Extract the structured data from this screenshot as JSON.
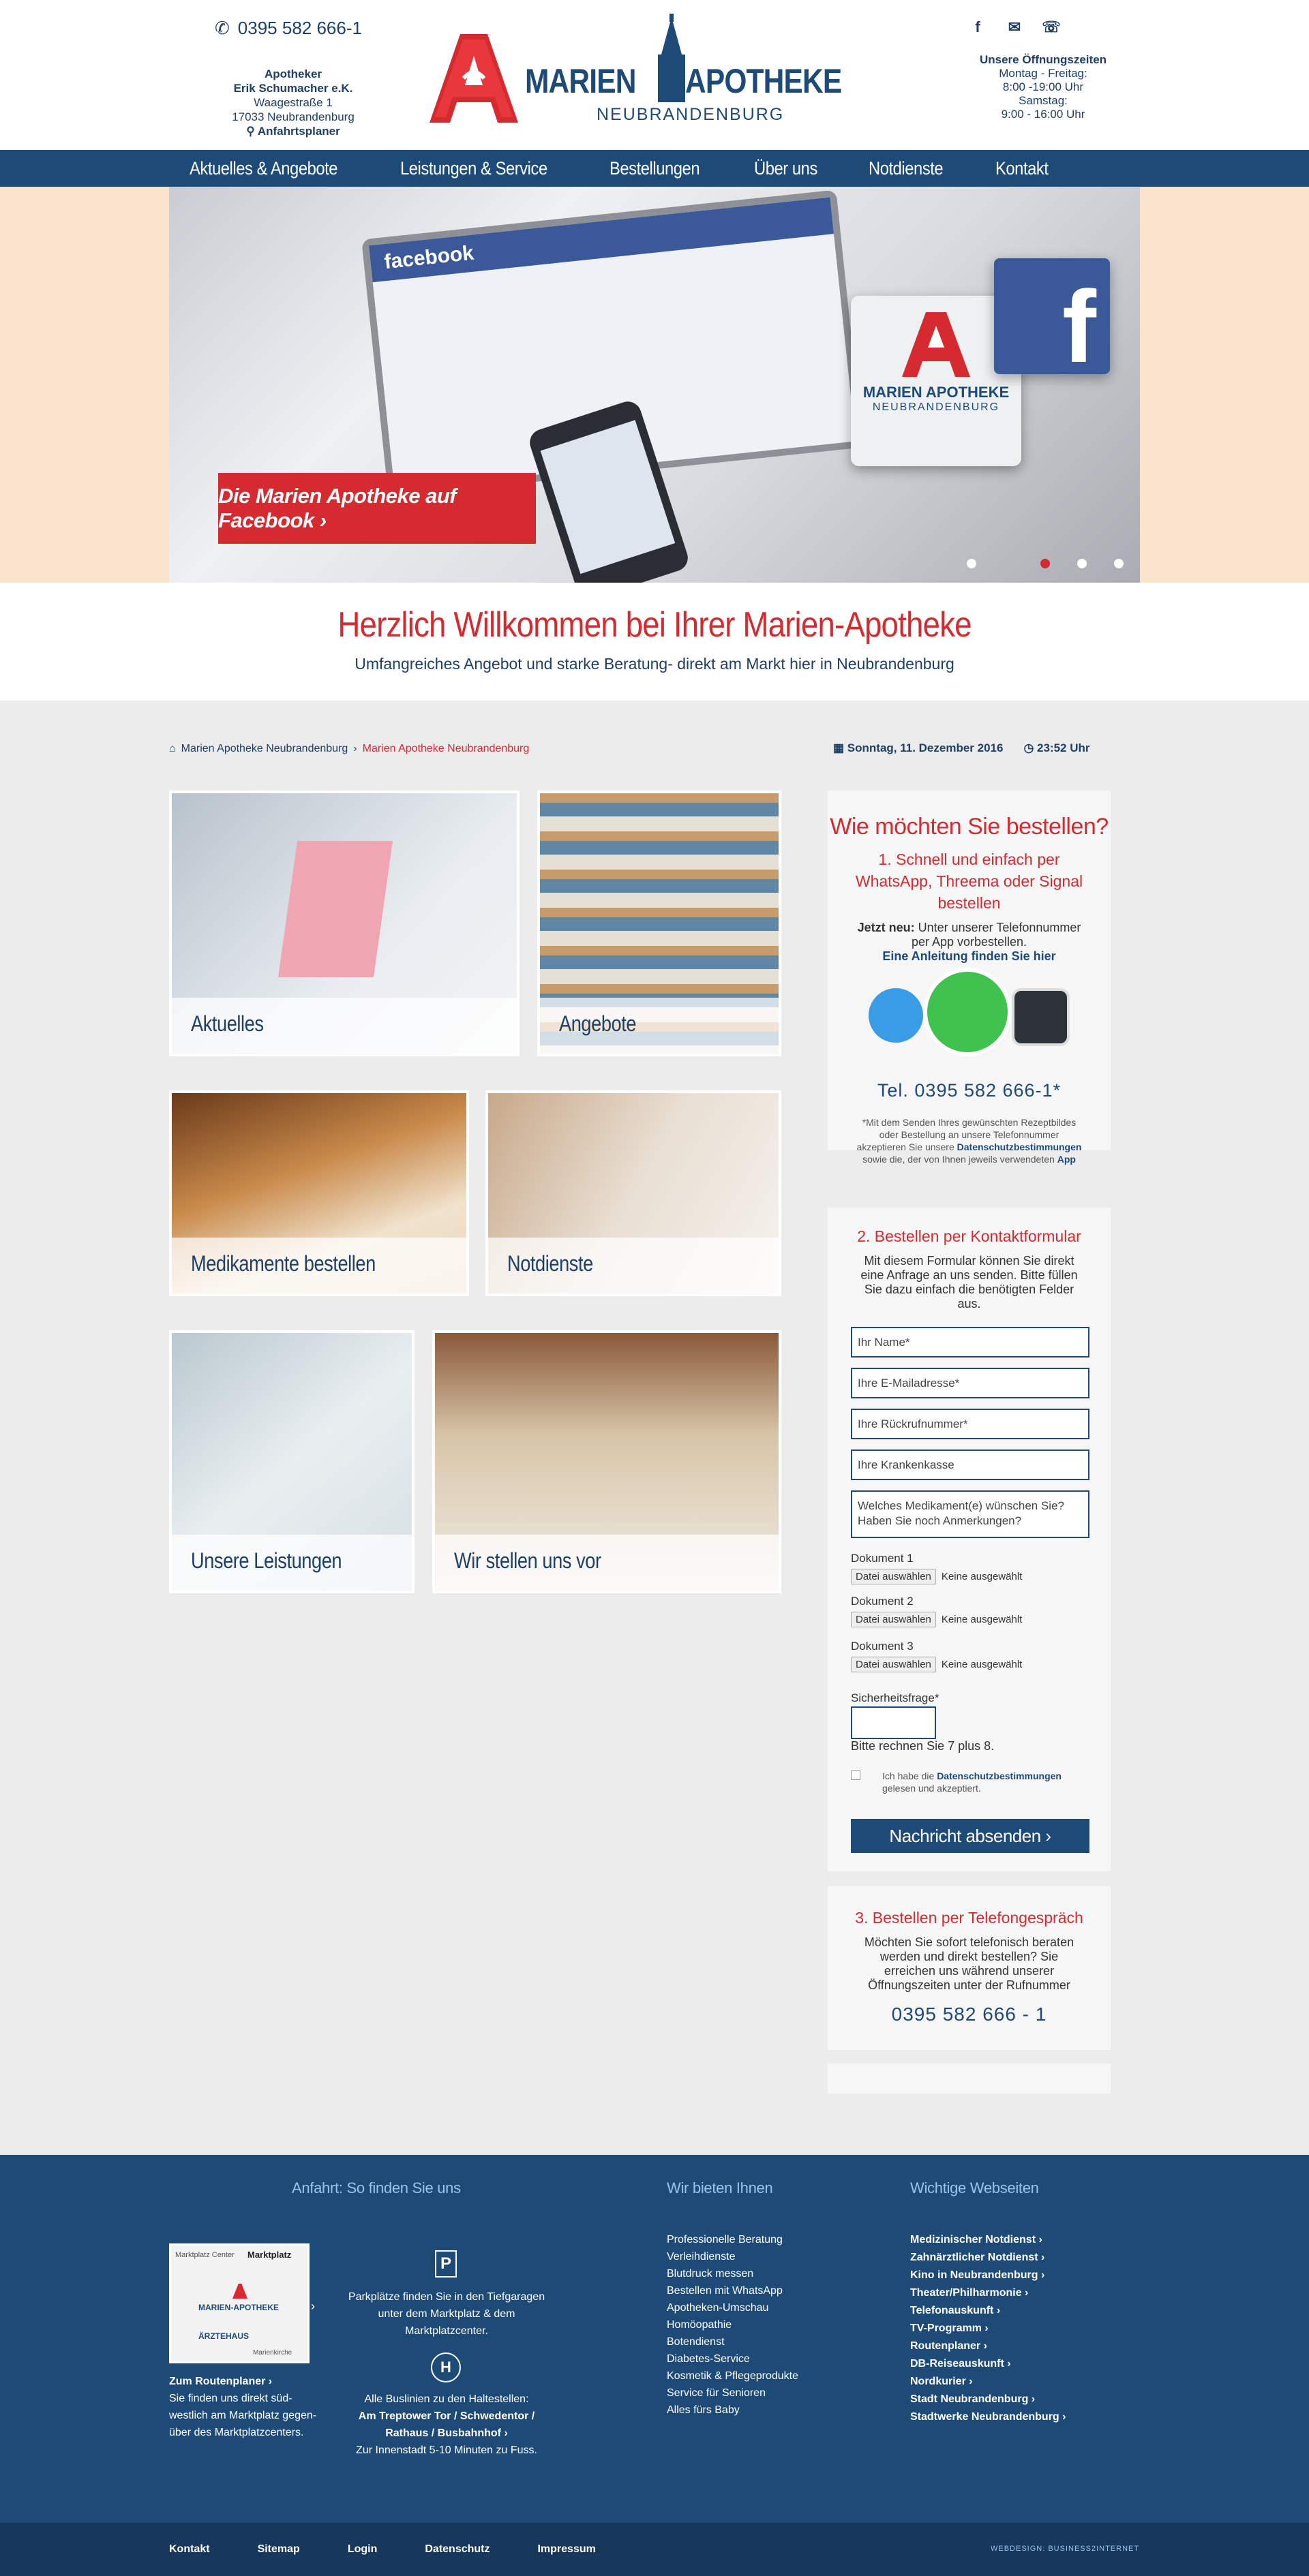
{
  "header": {
    "phone": "0395 582 666-1",
    "address": {
      "line1": "Apotheker",
      "line2": "Erik Schumacher e.K.",
      "line3": "Waagestraße 1",
      "line4": "17033 Neubrandenburg",
      "route_link": "Anfahrtsplaner"
    },
    "logo": {
      "word1": "MARIEN",
      "word2": "APOTHEKE",
      "city": "NEUBRANDENBURG"
    },
    "hours": {
      "title": "Unsere Öffnungszeiten",
      "line1": "Montag - Freitag:",
      "line2": "8:00 -19:00 Uhr",
      "line3": "Samstag:",
      "line4": "9:00 - 16:00 Uhr"
    }
  },
  "nav": {
    "items": [
      {
        "label": "Aktuelles & Angebote"
      },
      {
        "label": "Leistungen & Service"
      },
      {
        "label": "Bestellungen"
      },
      {
        "label": "Über uns"
      },
      {
        "label": "Notdienste"
      },
      {
        "label": "Kontakt"
      }
    ]
  },
  "hero": {
    "button": "Die Marien Apotheke auf Facebook ›",
    "screen_brand": "facebook",
    "badge_word1": "MARIEN APOTHEKE",
    "badge_word2": "NEUBRANDENBURG",
    "fb_letter": "f",
    "active_slide": 3,
    "slides": 5
  },
  "welcome": {
    "title": "Herzlich Willkommen bei Ihrer Marien-Apotheke",
    "subtitle": "Umfangreiches Angebot und starke Beratung- direkt am Markt hier in Neubrandenburg"
  },
  "breadcrumb": {
    "home": "Marien Apotheke Neubrandenburg",
    "current": "Marien Apotheke Neubrandenburg"
  },
  "datetime": {
    "date": "Sonntag, 11. Dezember 2016",
    "time": "23:52 Uhr"
  },
  "tiles": [
    {
      "label": "Aktuelles"
    },
    {
      "label": "Angebote"
    },
    {
      "label": "Medikamente bestellen"
    },
    {
      "label": "Notdienste"
    },
    {
      "label": "Unsere Leistungen"
    },
    {
      "label": "Wir stellen uns vor"
    }
  ],
  "order": {
    "title": "Wie möchten Sie bestellen?",
    "sub1": "1. Schnell und einfach per WhatsApp, Threema oder Signal bestellen",
    "new_label": "Jetzt neu:",
    "new_text": "Unter unserer Telefonnummer per App vorbestellen.",
    "guide_link": "Eine Anleitung finden Sie hier",
    "tel": "Tel. 0395 582 666-1*",
    "footnote_a": "*Mit dem Senden Ihres gewünschten Rezeptbildes oder Bestellung an unsere Telefonnummer akzeptieren Sie unsere",
    "footnote_link": "Datenschutzbestimmungen",
    "footnote_b": "sowie die, der von Ihnen jeweils verwendeten",
    "footnote_app": "App"
  },
  "contact_form": {
    "title": "2. Bestellen per Kontaktformular",
    "intro": "Mit diesem Formular können Sie direkt eine Anfrage an uns senden. Bitte füllen Sie dazu einfach die benötigten Felder aus.",
    "name_placeholder": "Ihr Name*",
    "email_placeholder": "Ihre E-Mailadresse*",
    "phone_placeholder": "Ihre Rückrufnummer*",
    "insurance_placeholder": "Ihre Krankenkasse",
    "message_placeholder": "Welches Medikament(e) wünschen Sie? Haben Sie noch Anmerkungen?",
    "doc1": "Dokument 1",
    "doc2": "Dokument 2",
    "doc3": "Dokument 3",
    "file_button": "Datei auswählen",
    "file_none": "Keine ausgewählt",
    "security_label": "Sicherheitsfrage*",
    "security_question": "Bitte rechnen Sie 7 plus 8.",
    "privacy_a": "Ich habe die",
    "privacy_link": "Datenschutzbestimmungen",
    "privacy_b": "gelesen und akzeptiert.",
    "submit": "Nachricht absenden ›"
  },
  "phone_order": {
    "title": "3. Bestellen per Telefongespräch",
    "text": "Möchten Sie sofort telefonisch beraten werden und direkt bestellen? Sie erreichen uns während unserer Öffnungszeiten unter der Rufnummer",
    "number": "0395 582 666 - 1"
  },
  "footer": {
    "directions": {
      "title": "Anfahrt: So finden Sie uns",
      "map_tl": "Marktplatz Center",
      "map_tr": "Marktplatz",
      "map_mid": "MARIEN-APOTHEKE",
      "map_bl": "ÄRZTEHAUS",
      "map_br": "Marienkirche",
      "route_link": "Zum Routenplaner ›",
      "route_text": "Sie finden uns direkt süd-westlich am Marktplatz gegen-über des Marktplatzcenters.",
      "parking_icon": "P",
      "parking_text": "Parkplätze finden Sie in den Tiefgaragen unter dem Marktplatz & dem Marktplatzcenter.",
      "bus_icon": "H",
      "bus_text": "Alle Buslinien zu den Haltestellen:",
      "bus_stops": "Am Treptower Tor / Schwedentor / Rathaus / Busbahnhof ›",
      "walk_text": "Zur Innenstadt 5-10 Minuten zu Fuss."
    },
    "offers": {
      "title": "Wir bieten Ihnen",
      "items": [
        "Professionelle Beratung",
        "Verleihdienste",
        "Blutdruck messen",
        "Bestellen mit WhatsApp",
        "Apotheken-Umschau",
        "Homöopathie",
        "Botendienst",
        "Diabetes-Service",
        "Kosmetik & Pflegeprodukte",
        "Service für Senioren",
        "Alles fürs Baby"
      ]
    },
    "links": {
      "title": "Wichtige Webseiten",
      "items": [
        "Medizinischer Notdienst ›",
        "Zahnärztlicher Notdienst ›",
        "Kino in Neubrandenburg ›",
        "Theater/Philharmonie ›",
        "Telefonauskunft ›",
        "TV-Programm ›",
        "Routenplaner ›",
        "DB-Reiseauskunft ›",
        "Nordkurier ›",
        "Stadt Neubrandenburg ›",
        "Stadtwerke Neubrandenburg ›"
      ]
    }
  },
  "bottombar": {
    "items": [
      "Kontakt",
      "Sitemap",
      "Login",
      "Datenschutz",
      "Impressum"
    ],
    "design": "WEBDESIGN: BUSINESS2INTERNET"
  },
  "colors": {
    "brand_red": "#d52a2f",
    "brand_blue": "#1e4a78",
    "light_blue": "#9bc3ec"
  }
}
